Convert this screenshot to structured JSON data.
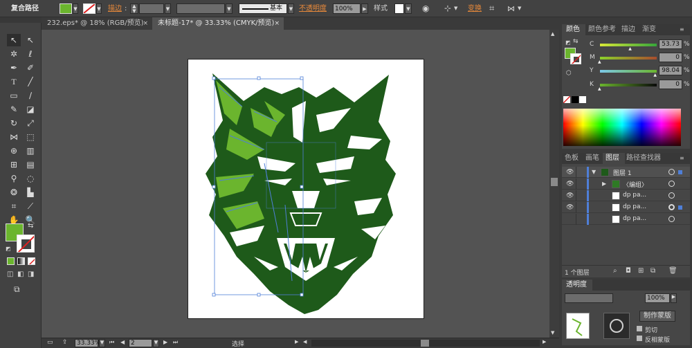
{
  "control_bar": {
    "object_type": "复合路径",
    "stroke_label": "描边",
    "stroke_style": "基本",
    "opacity_label": "不透明度",
    "opacity_value": "100%",
    "style_label": "样式",
    "transform_label": "变换"
  },
  "colors": {
    "fill": "#6bb52e",
    "accent_orange": "#e8893a",
    "wolf_dark": "#1e5a1a",
    "wolf_light": "#6bb52e",
    "selection_blue": "#4f7fd8"
  },
  "doc_tabs": [
    {
      "label": "232.eps* @ 18% (RGB/预览)",
      "close": "×"
    },
    {
      "label": "未标题-17* @ 33.33% (CMYK/预览)",
      "close": "×"
    }
  ],
  "status_bar": {
    "zoom": "33.33%",
    "page": "2",
    "tool": "选择"
  },
  "color_panel": {
    "tabs": [
      "颜色",
      "颜色参考",
      "描边",
      "渐变"
    ],
    "channels": [
      {
        "label": "C",
        "value": "53.73",
        "unit": "%",
        "fraction": 0.54
      },
      {
        "label": "M",
        "value": "0",
        "unit": "%",
        "fraction": 0.0
      },
      {
        "label": "Y",
        "value": "98.04",
        "unit": "%",
        "fraction": 0.98
      },
      {
        "label": "K",
        "value": "0",
        "unit": "%",
        "fraction": 0.0
      }
    ]
  },
  "layers_panel": {
    "tabs": [
      "色板",
      "画笔",
      "图层",
      "路径查找器"
    ],
    "rows": [
      {
        "name": "图层 1",
        "expander": "▼"
      },
      {
        "name": "〈编组〉",
        "expander": "▶"
      },
      {
        "name": "dp pa..."
      },
      {
        "name": "dp pa..."
      },
      {
        "name": "dp pa..."
      }
    ],
    "eye": "👁",
    "layer_count": "1 个图层"
  },
  "transparency_panel": {
    "title": "透明度",
    "opacity_value": "100%",
    "make_mask": "制作蒙版",
    "clip": "剪切",
    "invert_mask": "反相蒙版"
  },
  "tool_icons": [
    "selection-tool-icon",
    "direct-selection-tool-icon",
    "magic-wand-icon",
    "lasso-icon",
    "pen-tool-icon",
    "curvature-icon",
    "type-tool-icon",
    "line-tool-icon",
    "rectangle-tool-icon",
    "paintbrush-icon",
    "pencil-icon",
    "eraser-icon",
    "rotate-icon",
    "scale-icon",
    "width-tool-icon",
    "free-transform-icon",
    "shape-builder-icon",
    "perspective-grid-icon",
    "mesh-tool-icon",
    "gradient-tool-icon",
    "eyedropper-icon",
    "blend-tool-icon",
    "symbol-sprayer-icon",
    "column-graph-icon",
    "artboard-tool-icon",
    "slice-tool-icon",
    "hand-tool-icon",
    "zoom-tool-icon"
  ]
}
